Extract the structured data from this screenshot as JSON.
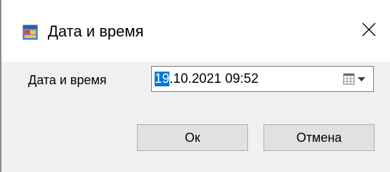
{
  "window": {
    "title": "Дата и время",
    "icon": "form-window-icon",
    "close_icon": "close-icon"
  },
  "form": {
    "label": "Дата и время",
    "datetime_day": "19",
    "datetime_rest": ".10.2021 09:52",
    "dropdown_icon": "calendar-dropdown-icon"
  },
  "buttons": {
    "ok": "Ок",
    "cancel": "Отмена"
  },
  "colors": {
    "selection": "#0078d7",
    "button_face": "#e1e1e1",
    "client_bg": "#f0f0f0"
  }
}
